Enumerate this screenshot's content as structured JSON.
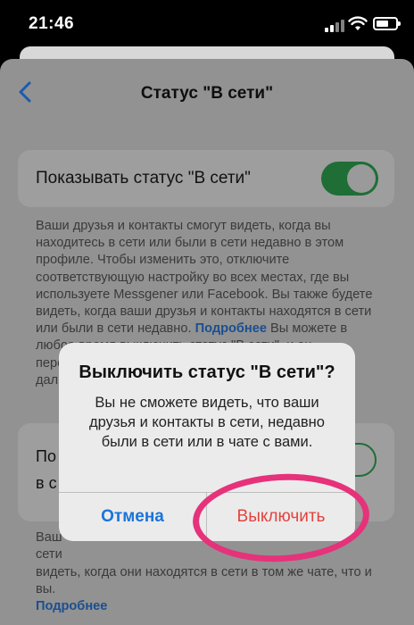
{
  "status_bar": {
    "time": "21:46"
  },
  "nav": {
    "title": "Статус \"В сети\"",
    "back_icon": "chevron-left-icon"
  },
  "setting1": {
    "label": "Показывать статус \"В сети\"",
    "enabled": true
  },
  "description": {
    "text": "Ваши друзья и контакты смогут видеть, когда вы находитесь в сети или были в сети недавно в этом профиле. Чтобы изменить это, отключите соответствующую настройку во всех местах, где вы используете Messgener или Facebook. Вы также будете видеть, когда ваши друзья и контакты находятся в сети или были в сети недавно.",
    "link": "Подробнее",
    "after_link": "Вы можете в любое время выключить статус \"В сети\", и он перестанет показываться. При этом вы сможете и дальше пользоваться нашими усл"
  },
  "setting2": {
    "label": "По\nв с"
  },
  "description2": {
    "text": "Ваш\nсети\nвидеть, когда они находятся в сети в том же чате, что и вы.",
    "link": "Подробнее"
  },
  "alert": {
    "title": "Выключить статус \"В сети\"?",
    "message": "Вы не сможете видеть, что ваши друзья и контакты в сети, недавно были в сети или в чате с вами.",
    "cancel_label": "Отмена",
    "confirm_label": "Выключить"
  },
  "colors": {
    "accent": "#1a73d9",
    "destructive": "#e3433f",
    "highlight": "#e6327a",
    "toggle_on": "#1e6e36"
  }
}
